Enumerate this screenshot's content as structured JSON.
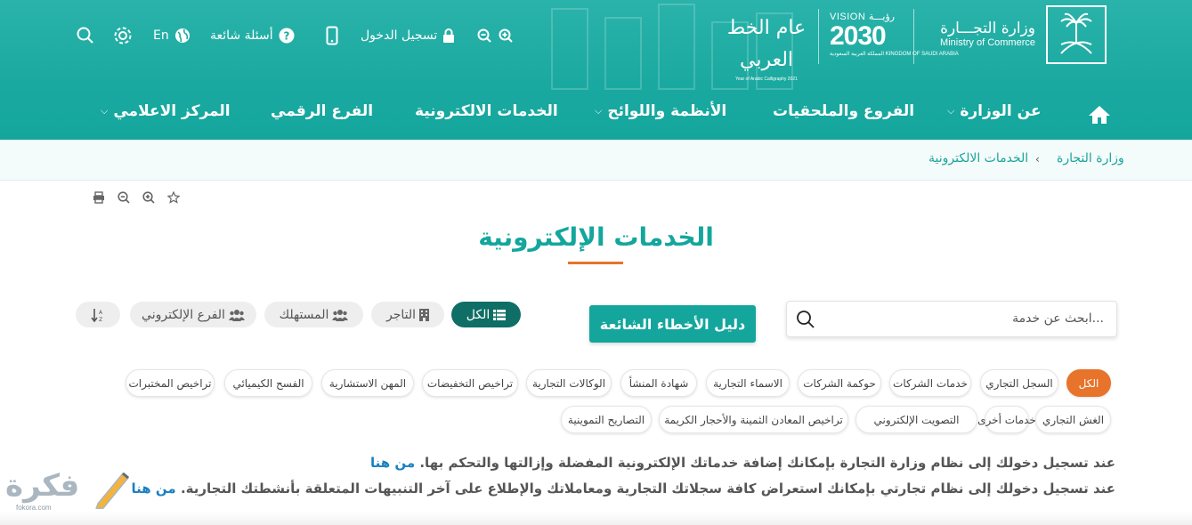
{
  "header": {
    "ministry_ar": "وزارة التجـــارة",
    "ministry_en": "Ministry of Commerce",
    "vision_top": "VISION رؤيـــة",
    "vision_year": "2030",
    "vision_sub": "المملكة العربية السعودية KINGDOM OF SAUDI ARABIA",
    "calligraphy_ar": "عام الخط العربي",
    "calligraphy_en": "Year of Arabic Calligraphy 2021",
    "topbar": {
      "login": "تسجيل الدخول",
      "faq": "أسئلة شائعة",
      "lang": "En"
    },
    "nav": {
      "home": "home",
      "about": "عن الوزارة",
      "branches": "الفروع والملحقيات",
      "regulations": "الأنظمة واللوائح",
      "eservices": "الخدمات الالكترونية",
      "digital_branch": "الفرع الرقمي",
      "media_center": "المركز الاعلامي"
    }
  },
  "breadcrumb": {
    "root": "وزارة التجارة",
    "current": "الخدمات الالكترونية"
  },
  "page": {
    "title": "الخدمات الإلكترونية",
    "search_placeholder": "ابحث عن خدمة...",
    "guide_button": "دليل الأخطاء الشائعة"
  },
  "filters": {
    "all": "الكل",
    "merchant": "التاجر",
    "consumer": "المستهلك",
    "digital_branch": "الفرع الإلكتروني"
  },
  "categories": {
    "row1": [
      "الكل",
      "السجل التجاري",
      "خدمات الشركات",
      "حوكمة الشركات",
      "الاسماء التجارية",
      "شهادة المنشأ",
      "الوكالات التجارية",
      "تراخيص التخفيضات",
      "المهن الاستشارية",
      "الفسح الكيميائي",
      "تراخيص المختبرات"
    ],
    "row2": [
      "الغش التجاري",
      "خدمات أخرى",
      "التصويت الإلكتروني",
      "تراخيص المعادن الثمينة والأحجار الكريمة",
      "التصاريح التموينية"
    ]
  },
  "paragraphs": {
    "p1_text": "عند تسجيل دخولك إلى نظام وزارة التجارة بإمكانك إضافة خدماتك الإلكترونية المفضلة وإزالتها والتحكم بها.",
    "p1_link": "من هنا",
    "p2_text": "عند تسجيل دخولك إلى نظام تجارتي بإمكانك استعراض كافة سجلاتك التجارية ومعاملاتك والإطلاع على آخر التنبيهات المتعلقة بأنشطتك التجارية.",
    "p2_link": "من هنا"
  },
  "watermark": {
    "brand_ar": "فكرة",
    "brand_en": "fokora.com"
  },
  "colors": {
    "teal": "#14a69d",
    "dark_teal": "#0f6e66",
    "orange": "#e8732b",
    "link": "#1a7fc0"
  }
}
